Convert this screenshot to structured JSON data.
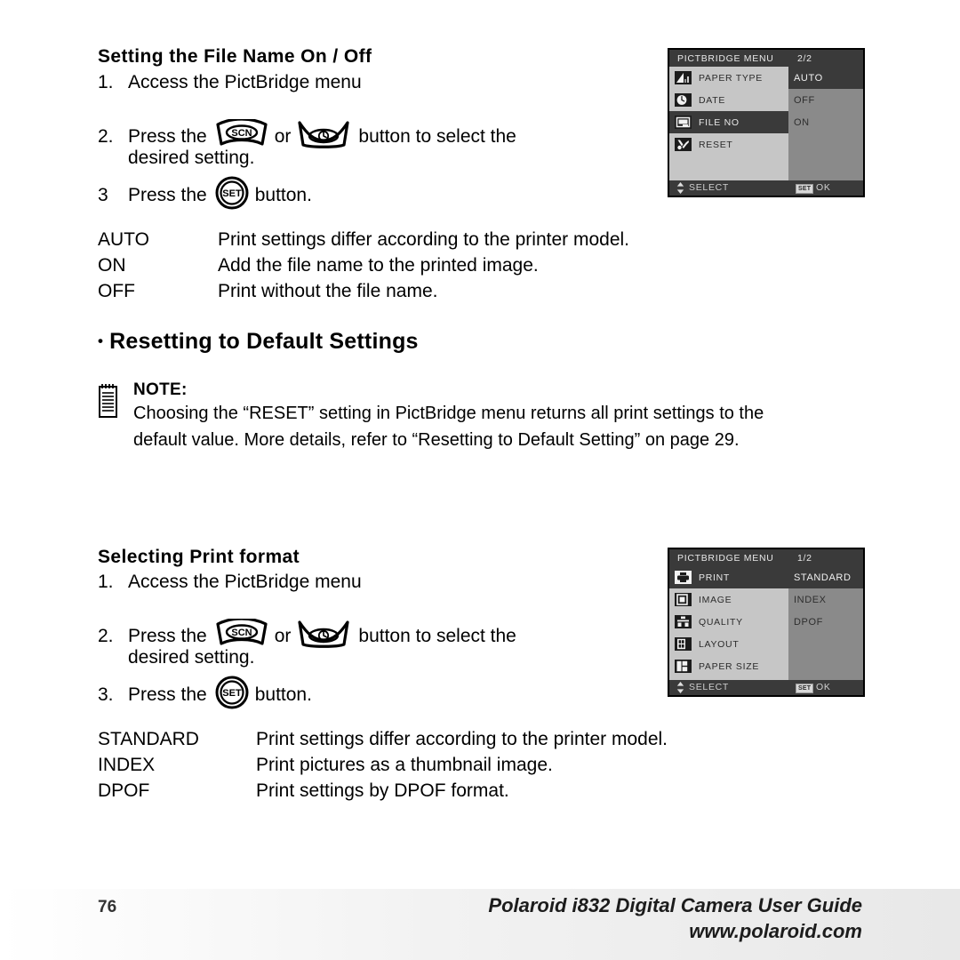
{
  "sections": {
    "file_name": {
      "heading": "Setting the File Name On / Off",
      "step1_num": "1.",
      "step1_text": "Access the PictBridge menu",
      "step2_num": "2.",
      "step2_pre": "Press the",
      "step2_or": "or",
      "step2_post": "button to select the",
      "step2_cont": "desired setting.",
      "step3_num": "3",
      "step3_pre": "Press the",
      "step3_post": "button.",
      "definitions": [
        {
          "term": "AUTO",
          "desc": "Print settings differ according to the printer model."
        },
        {
          "term": "ON",
          "desc": "Add the file name to the printed image."
        },
        {
          "term": "OFF",
          "desc": "Print without the file name."
        }
      ]
    },
    "resetting": {
      "bullet": "•",
      "heading": "Resetting to Default Settings",
      "note_title": "NOTE:",
      "note_line1": "Choosing the “RESET” setting in PictBridge menu returns all print settings to the",
      "note_line2": "default value. More details, refer to “Resetting to Default Setting” on page 29."
    },
    "print_format": {
      "heading": "Selecting Print format",
      "step1_num": "1.",
      "step1_text": "Access the PictBridge menu",
      "step2_num": "2.",
      "step2_pre": "Press the",
      "step2_or": "or",
      "step2_post": "button to select the",
      "step2_cont": "desired setting.",
      "step3_num": "3.",
      "step3_pre": "Press the",
      "step3_post": "button.",
      "definitions": [
        {
          "term": "STANDARD",
          "desc": "Print settings differ according to the printer model."
        },
        {
          "term": "INDEX",
          "desc": "Print pictures as a thumbnail image."
        },
        {
          "term": "DPOF",
          "desc": "Print settings by DPOF format."
        }
      ]
    }
  },
  "buttons": {
    "scn_label": "SCN",
    "set_label": "SET",
    "timer_name": "self-timer-button"
  },
  "lcd_top": {
    "title": "PICTBRIDGE MENU",
    "page": "2/2",
    "menu_items": [
      {
        "label": "PAPER TYPE",
        "icon": "gradient-bars-icon",
        "selected": false
      },
      {
        "label": "DATE",
        "icon": "clock-icon",
        "selected": false
      },
      {
        "label": "FILE NO",
        "icon": "file-number-icon",
        "selected": true
      },
      {
        "label": "RESET",
        "icon": "tools-icon",
        "selected": false
      }
    ],
    "options": [
      {
        "label": "AUTO",
        "selected": true
      },
      {
        "label": "OFF",
        "selected": false
      },
      {
        "label": "ON",
        "selected": false
      }
    ],
    "footer_select": "SELECT",
    "footer_set_badge": "SET",
    "footer_ok": "OK"
  },
  "lcd_bottom": {
    "title": "PICTBRIDGE MENU",
    "page": "1/2",
    "menu_items": [
      {
        "label": "PRINT",
        "icon": "printer-icon",
        "selected": true
      },
      {
        "label": "IMAGE",
        "icon": "image-frame-icon",
        "selected": false
      },
      {
        "label": "QUALITY",
        "icon": "quality-icon",
        "selected": false
      },
      {
        "label": "LAYOUT",
        "icon": "layout-icon",
        "selected": false
      },
      {
        "label": "PAPER SIZE",
        "icon": "paper-size-icon",
        "selected": false
      }
    ],
    "options": [
      {
        "label": "STANDARD",
        "selected": true
      },
      {
        "label": "INDEX",
        "selected": false
      },
      {
        "label": "DPOF",
        "selected": false
      }
    ],
    "footer_select": "SELECT",
    "footer_set_badge": "SET",
    "footer_ok": "OK"
  },
  "footer": {
    "page_number": "76",
    "guide_title": "Polaroid i832 Digital Camera User Guide",
    "website": "www.polaroid.com"
  },
  "colors": {
    "lcd_header": "#3a3a3a",
    "lcd_left": "#c6c6c6",
    "lcd_right": "#8a8a8a",
    "selection": "#3a3a3a",
    "icon": "#1c1c1c"
  }
}
